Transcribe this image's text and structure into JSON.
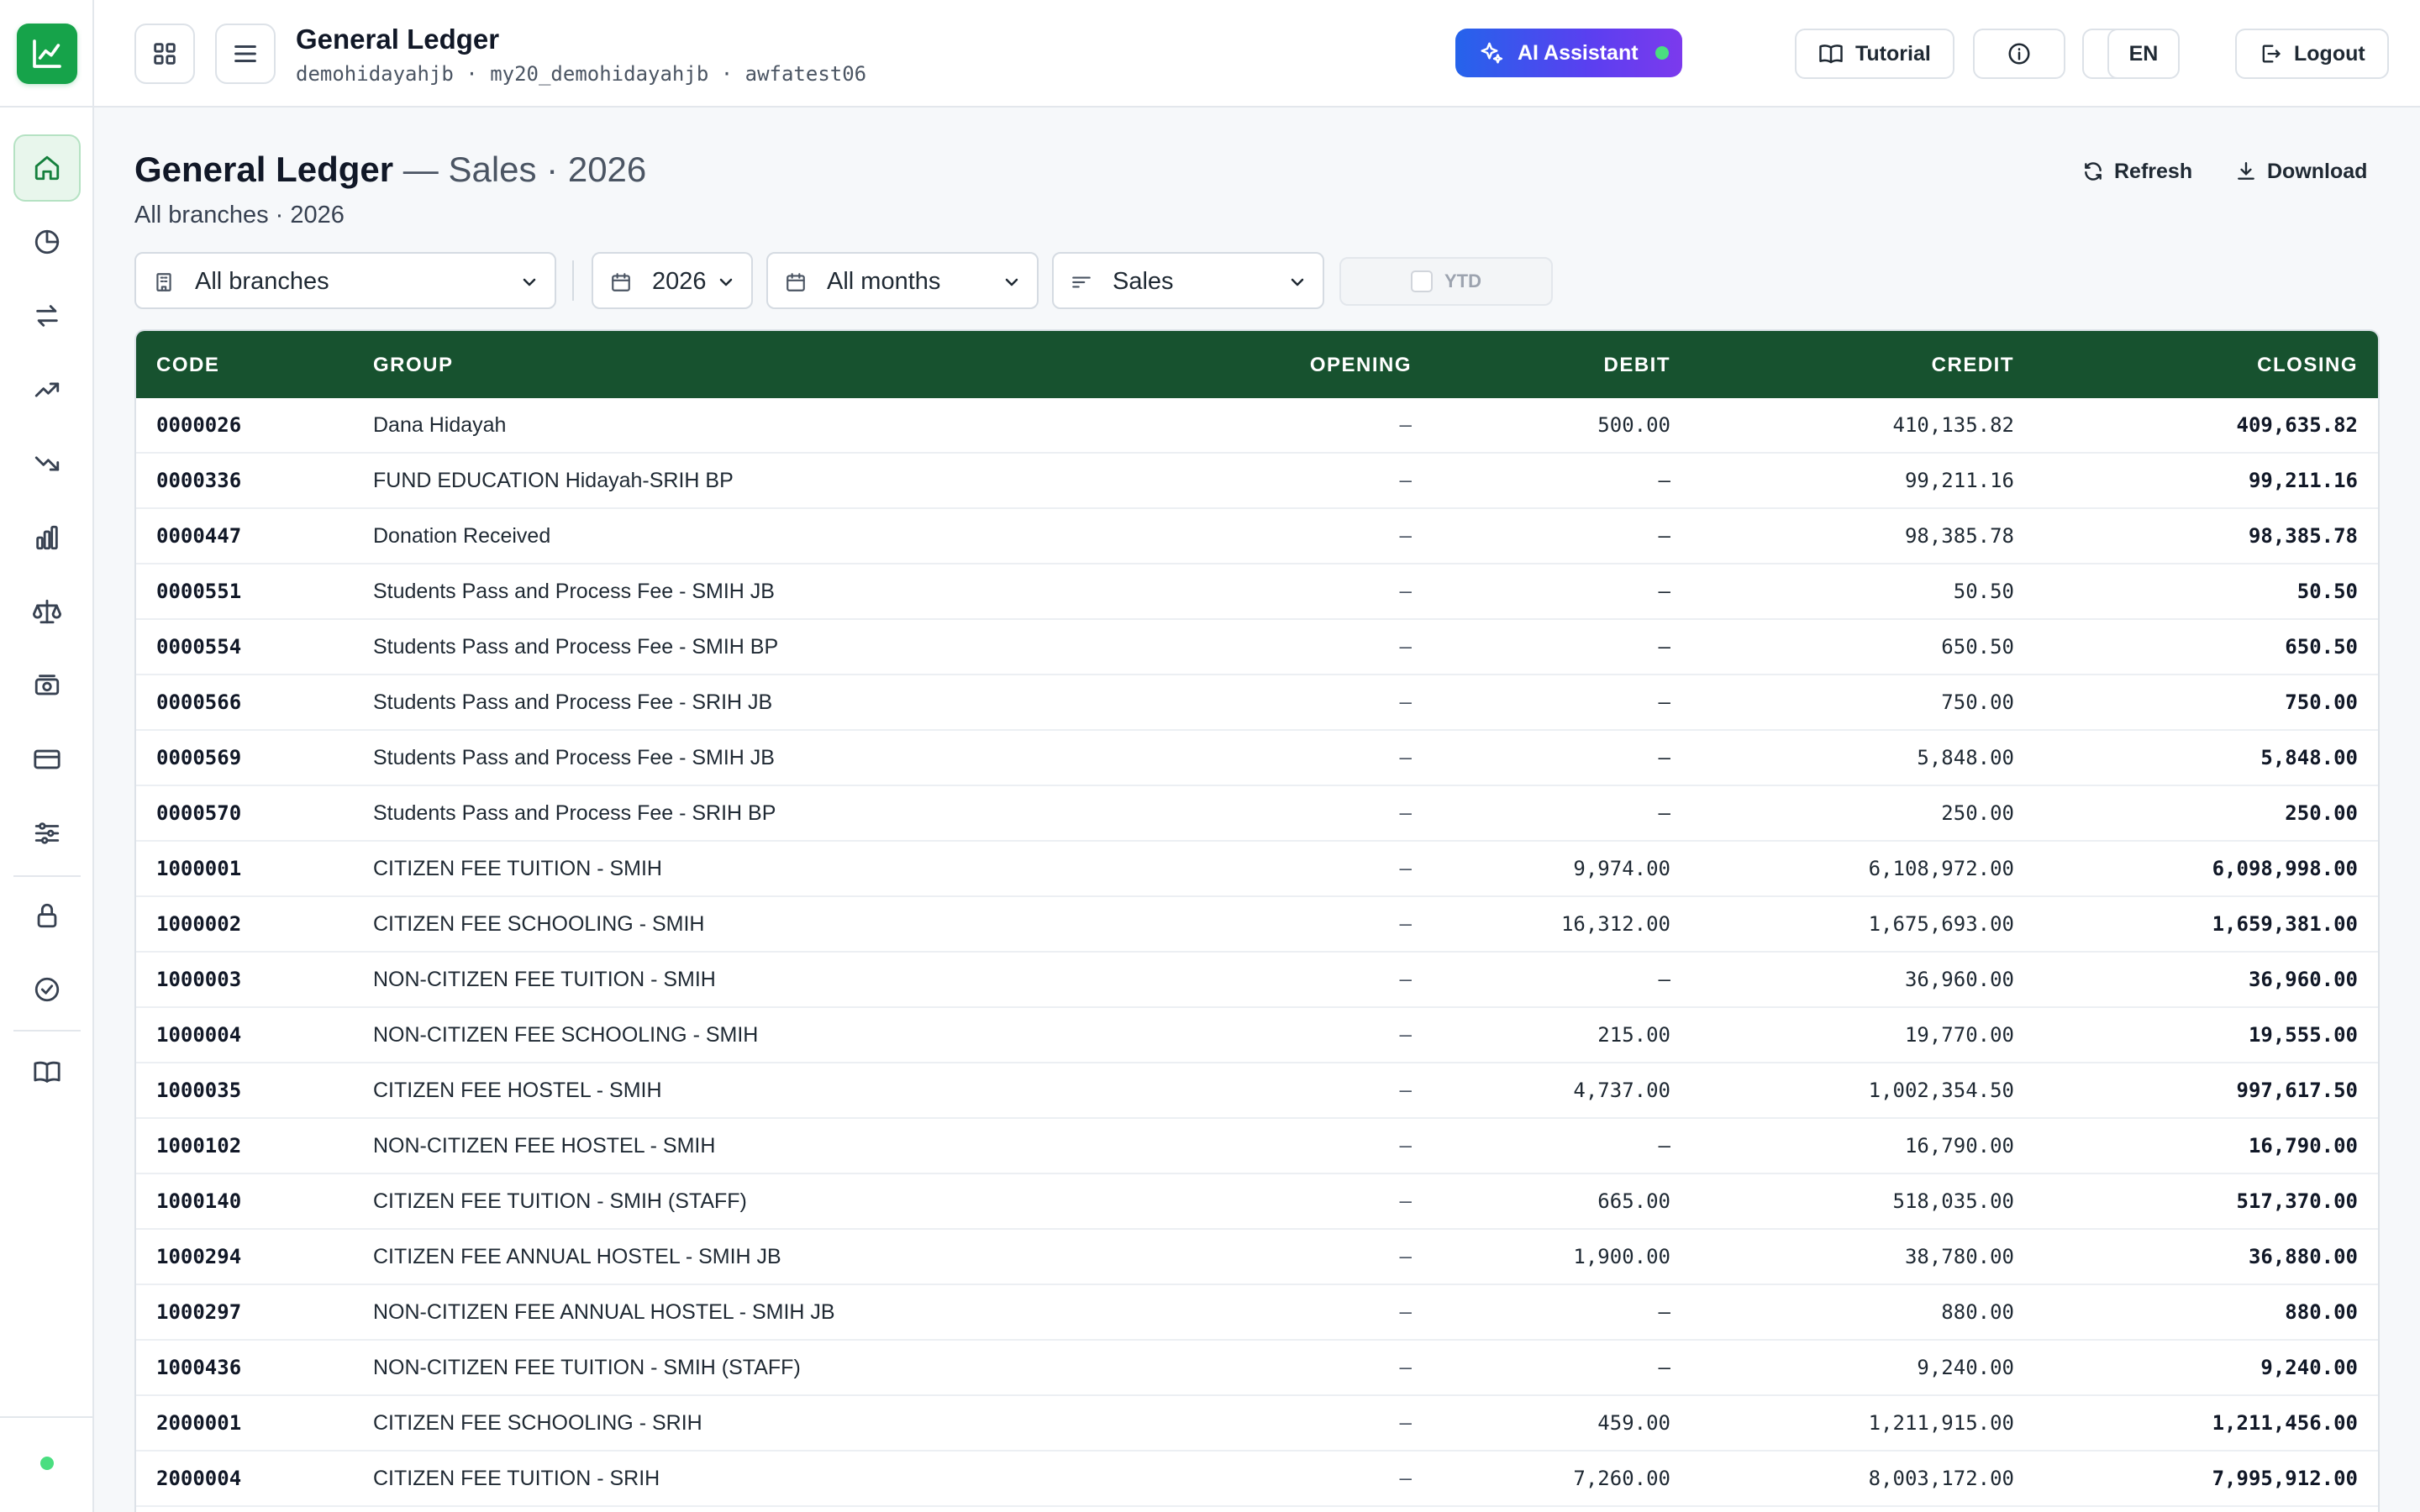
{
  "sidebar": {
    "items": [
      {
        "icon": "home-icon",
        "active": true
      },
      {
        "icon": "pie-chart-icon"
      },
      {
        "icon": "transfer-arrows-icon"
      },
      {
        "icon": "trending-up-icon"
      },
      {
        "icon": "trending-down-icon"
      },
      {
        "icon": "bar-chart-icon"
      },
      {
        "icon": "scale-icon"
      },
      {
        "icon": "cash-icon"
      },
      {
        "icon": "credit-card-icon"
      },
      {
        "icon": "sliders-icon"
      },
      {
        "icon": "lock-icon"
      },
      {
        "icon": "check-circle-icon"
      },
      {
        "icon": "book-icon"
      }
    ],
    "status_color": "#4ade80"
  },
  "header": {
    "title": "General Ledger",
    "subtitle": "demohidayahjb · my20_demohidayahjb · awfatest06",
    "ai_label": "AI Assistant",
    "tutorial_label": "Tutorial",
    "language": "EN",
    "logout_label": "Logout"
  },
  "page": {
    "title_bold": "General Ledger",
    "title_rest": " — Sales · 2026",
    "subtitle": "All branches · 2026",
    "refresh_label": "Refresh",
    "download_label": "Download"
  },
  "filters": {
    "branch": "All branches",
    "year": "2026",
    "month": "All months",
    "type": "Sales",
    "ytd_label": "YTD"
  },
  "table": {
    "columns": {
      "code": "CODE",
      "group": "GROUP",
      "opening": "OPENING",
      "debit": "DEBIT",
      "credit": "CREDIT",
      "closing": "CLOSING"
    },
    "rows": [
      {
        "code": "0000026",
        "group": "Dana Hidayah",
        "opening": "–",
        "debit": "500.00",
        "credit": "410,135.82",
        "closing": "409,635.82"
      },
      {
        "code": "0000336",
        "group": "FUND EDUCATION Hidayah-SRIH BP",
        "opening": "–",
        "debit": "–",
        "credit": "99,211.16",
        "closing": "99,211.16"
      },
      {
        "code": "0000447",
        "group": "Donation Received",
        "opening": "–",
        "debit": "–",
        "credit": "98,385.78",
        "closing": "98,385.78"
      },
      {
        "code": "0000551",
        "group": "Students Pass and Process Fee - SMIH JB",
        "opening": "–",
        "debit": "–",
        "credit": "50.50",
        "closing": "50.50"
      },
      {
        "code": "0000554",
        "group": "Students Pass and Process Fee - SMIH BP",
        "opening": "–",
        "debit": "–",
        "credit": "650.50",
        "closing": "650.50"
      },
      {
        "code": "0000566",
        "group": "Students Pass and Process Fee - SRIH JB",
        "opening": "–",
        "debit": "–",
        "credit": "750.00",
        "closing": "750.00"
      },
      {
        "code": "0000569",
        "group": "Students Pass and Process Fee - SMIH JB",
        "opening": "–",
        "debit": "–",
        "credit": "5,848.00",
        "closing": "5,848.00"
      },
      {
        "code": "0000570",
        "group": "Students Pass and Process Fee - SRIH BP",
        "opening": "–",
        "debit": "–",
        "credit": "250.00",
        "closing": "250.00"
      },
      {
        "code": "1000001",
        "group": "CITIZEN FEE TUITION - SMIH",
        "opening": "–",
        "debit": "9,974.00",
        "credit": "6,108,972.00",
        "closing": "6,098,998.00"
      },
      {
        "code": "1000002",
        "group": "CITIZEN FEE SCHOOLING - SMIH",
        "opening": "–",
        "debit": "16,312.00",
        "credit": "1,675,693.00",
        "closing": "1,659,381.00"
      },
      {
        "code": "1000003",
        "group": "NON-CITIZEN FEE TUITION - SMIH",
        "opening": "–",
        "debit": "–",
        "credit": "36,960.00",
        "closing": "36,960.00"
      },
      {
        "code": "1000004",
        "group": "NON-CITIZEN FEE SCHOOLING - SMIH",
        "opening": "–",
        "debit": "215.00",
        "credit": "19,770.00",
        "closing": "19,555.00"
      },
      {
        "code": "1000035",
        "group": "CITIZEN FEE HOSTEL - SMIH",
        "opening": "–",
        "debit": "4,737.00",
        "credit": "1,002,354.50",
        "closing": "997,617.50"
      },
      {
        "code": "1000102",
        "group": "NON-CITIZEN FEE HOSTEL - SMIH",
        "opening": "–",
        "debit": "–",
        "credit": "16,790.00",
        "closing": "16,790.00"
      },
      {
        "code": "1000140",
        "group": "CITIZEN FEE TUITION - SMIH (STAFF)",
        "opening": "–",
        "debit": "665.00",
        "credit": "518,035.00",
        "closing": "517,370.00"
      },
      {
        "code": "1000294",
        "group": "CITIZEN FEE ANNUAL HOSTEL - SMIH JB",
        "opening": "–",
        "debit": "1,900.00",
        "credit": "38,780.00",
        "closing": "36,880.00"
      },
      {
        "code": "1000297",
        "group": "NON-CITIZEN FEE ANNUAL HOSTEL - SMIH JB",
        "opening": "–",
        "debit": "–",
        "credit": "880.00",
        "closing": "880.00"
      },
      {
        "code": "1000436",
        "group": "NON-CITIZEN FEE TUITION - SMIH (STAFF)",
        "opening": "–",
        "debit": "–",
        "credit": "9,240.00",
        "closing": "9,240.00"
      },
      {
        "code": "2000001",
        "group": "CITIZEN FEE SCHOOLING - SRIH",
        "opening": "–",
        "debit": "459.00",
        "credit": "1,211,915.00",
        "closing": "1,211,456.00"
      },
      {
        "code": "2000004",
        "group": "CITIZEN FEE TUITION - SRIH",
        "opening": "–",
        "debit": "7,260.00",
        "credit": "8,003,172.00",
        "closing": "7,995,912.00"
      }
    ]
  },
  "colors": {
    "brand": "#16a34a",
    "table_header": "#17522f",
    "ai_gradient_start": "#2563eb",
    "ai_gradient_end": "#7c3aed"
  }
}
